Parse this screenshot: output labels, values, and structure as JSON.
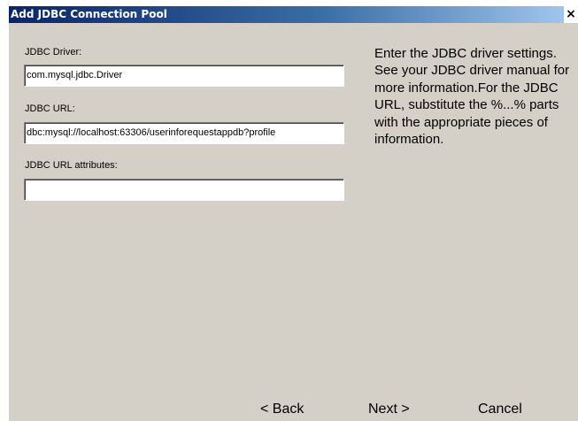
{
  "window": {
    "title": "Add JDBC Connection Pool",
    "close_glyph": "×",
    "close_icon": "close-icon"
  },
  "form": {
    "driver_label": "JDBC Driver:",
    "driver_value": "com.mysql.jdbc.Driver",
    "url_label": "JDBC URL:",
    "url_value": "dbc:mysql://localhost:63306/userinforequestappdb?profile",
    "attributes_label": "JDBC URL attributes:",
    "attributes_value": ""
  },
  "help": {
    "text": "Enter the JDBC driver settings.  See your JDBC driver manual for more information.For the JDBC URL, substitute the %...% parts with the appropriate pieces of information."
  },
  "buttons": {
    "back_label": "< Back",
    "next_label": "Next >",
    "cancel_label": "Cancel"
  },
  "colors": {
    "dialog_background": "#d4d0c8",
    "titlebar_start": "#0a246a",
    "titlebar_end": "#a6caf0",
    "title_text": "#ffffff"
  }
}
